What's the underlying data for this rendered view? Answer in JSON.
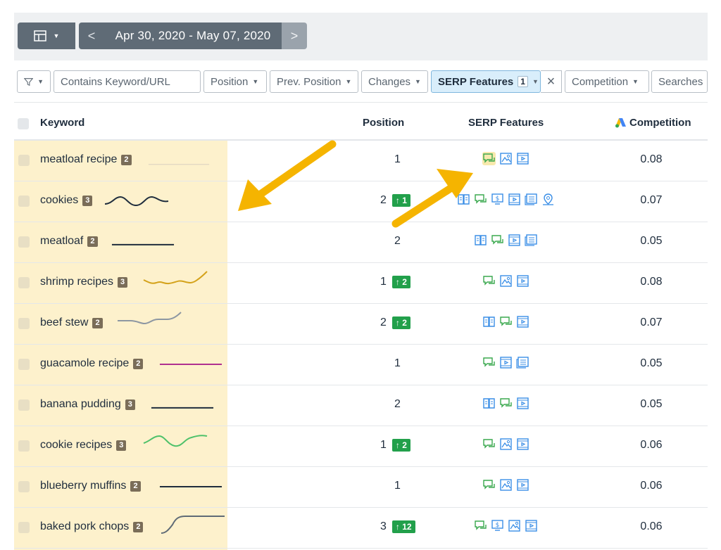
{
  "toolbar": {
    "date_range": "Apr 30, 2020 - May 07, 2020",
    "prev_glyph": "<",
    "next_glyph": ">"
  },
  "filters": {
    "search_placeholder": "Contains Keyword/URL",
    "position": "Position",
    "prev_position": "Prev. Position",
    "changes": "Changes",
    "serp_features": "SERP Features",
    "serp_features_count": "1",
    "competition": "Competition",
    "searches": "Searches"
  },
  "table": {
    "headers": {
      "keyword": "Keyword",
      "position": "Position",
      "serp_features": "SERP Features",
      "competition": "Competition"
    },
    "rows": [
      {
        "keyword": "meatloaf recipe",
        "count": "2",
        "position": "1",
        "change": "",
        "features": [
          "review",
          "image",
          "video"
        ],
        "competition": "0.08"
      },
      {
        "keyword": "cookies",
        "count": "3",
        "position": "2",
        "change": "1",
        "features": [
          "knowledge",
          "review",
          "shopping",
          "video",
          "news",
          "local"
        ],
        "competition": "0.07"
      },
      {
        "keyword": "meatloaf",
        "count": "2",
        "position": "2",
        "change": "",
        "features": [
          "knowledge",
          "review",
          "video",
          "news"
        ],
        "competition": "0.05"
      },
      {
        "keyword": "shrimp recipes",
        "count": "3",
        "position": "1",
        "change": "2",
        "features": [
          "review",
          "image",
          "video"
        ],
        "competition": "0.08"
      },
      {
        "keyword": "beef stew",
        "count": "2",
        "position": "2",
        "change": "2",
        "features": [
          "knowledge",
          "review",
          "video"
        ],
        "competition": "0.07"
      },
      {
        "keyword": "guacamole recipe",
        "count": "2",
        "position": "1",
        "change": "",
        "features": [
          "review",
          "video",
          "news"
        ],
        "competition": "0.05"
      },
      {
        "keyword": "banana pudding",
        "count": "3",
        "position": "2",
        "change": "",
        "features": [
          "knowledge",
          "review",
          "video"
        ],
        "competition": "0.05"
      },
      {
        "keyword": "cookie recipes",
        "count": "3",
        "position": "1",
        "change": "2",
        "features": [
          "review",
          "image",
          "video"
        ],
        "competition": "0.06"
      },
      {
        "keyword": "blueberry muffins",
        "count": "2",
        "position": "1",
        "change": "",
        "features": [
          "review",
          "image",
          "video"
        ],
        "competition": "0.06"
      },
      {
        "keyword": "baked pork chops",
        "count": "2",
        "position": "3",
        "change": "12",
        "features": [
          "review",
          "shopping",
          "image",
          "video"
        ],
        "competition": "0.06"
      }
    ]
  },
  "colors": {
    "accent_blue": "#3a8ee6",
    "feature_green": "#3aa84e",
    "change_green": "#22a04b",
    "highlight_yellow": "#fdf1cc",
    "arrow_orange": "#f5b400",
    "toolbar_gray": "#5f6b76"
  },
  "icons": {
    "view": "layout-icon",
    "filter": "filter-funnel-icon",
    "close": "close-icon",
    "ads": "google-ads-icon"
  }
}
